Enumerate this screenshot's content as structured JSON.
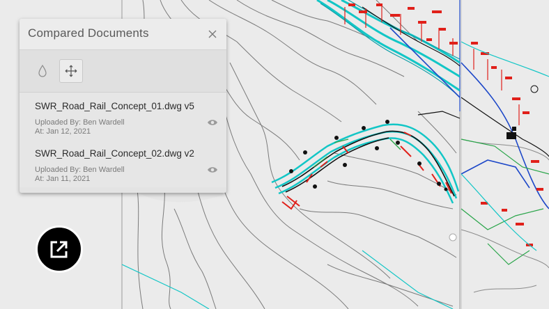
{
  "panel": {
    "title": "Compared Documents",
    "close_icon": "close-icon",
    "tools": [
      {
        "icon": "droplet-icon",
        "active": false
      },
      {
        "icon": "move-icon",
        "active": true
      }
    ]
  },
  "documents": [
    {
      "name": "SWR_Road_Rail_Concept_01.dwg v5",
      "uploaded_by": "Uploaded By: Ben Wardell",
      "date": "At: Jan 12, 2021",
      "icon": "eye-icon"
    },
    {
      "name": "SWR_Road_Rail_Concept_02.dwg v2",
      "uploaded_by": "Uploaded By: Ben Wardell",
      "date": "At: Jan 11, 2021",
      "icon": "eye-icon"
    }
  ],
  "external_link_icon": "external-link-icon",
  "colors": {
    "accent_cyan": "#12c6c6",
    "red_markup": "#e0201a",
    "blue_line": "#1c47c8",
    "green_line": "#2aa54a",
    "contour": "#777777"
  }
}
